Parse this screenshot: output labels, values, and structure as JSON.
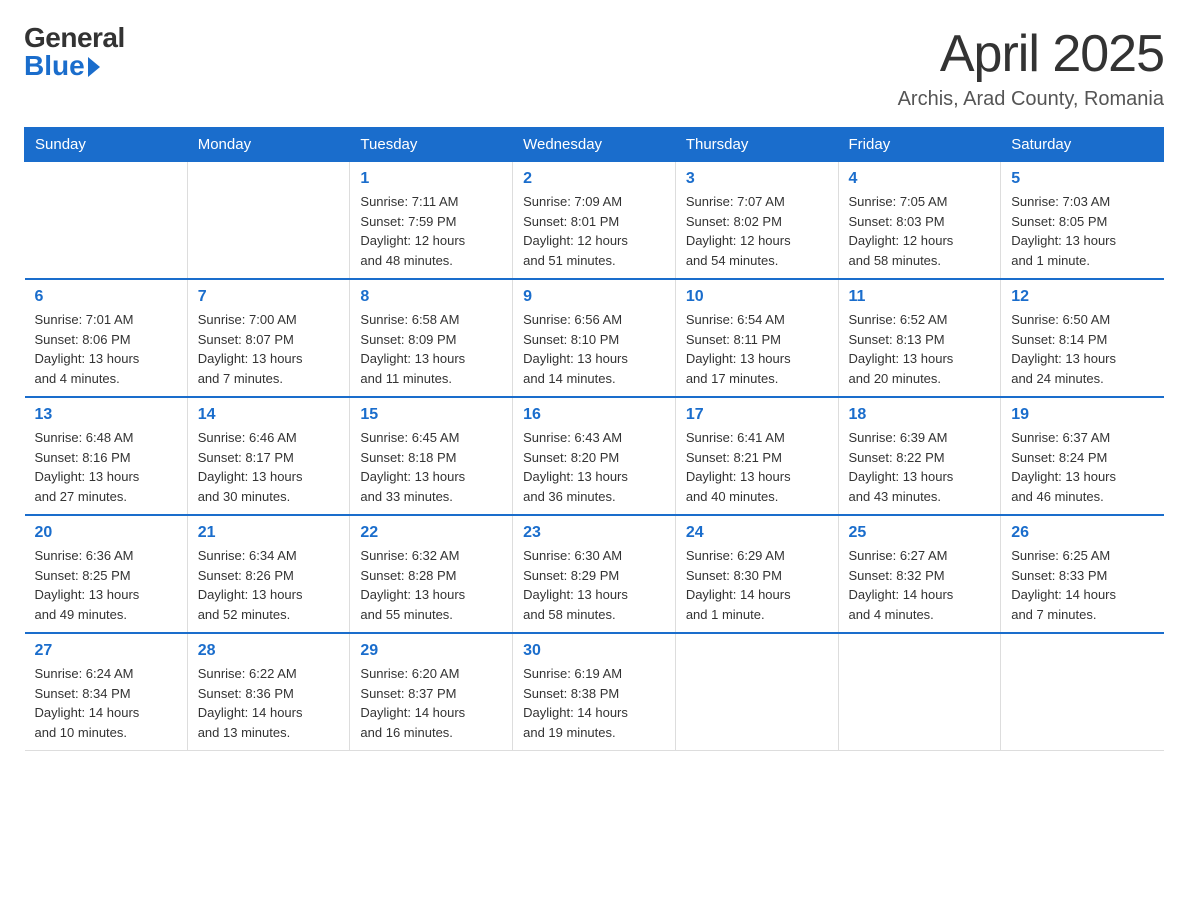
{
  "logo": {
    "general": "General",
    "blue": "Blue"
  },
  "header": {
    "title": "April 2025",
    "subtitle": "Archis, Arad County, Romania"
  },
  "days_header": [
    "Sunday",
    "Monday",
    "Tuesday",
    "Wednesday",
    "Thursday",
    "Friday",
    "Saturday"
  ],
  "weeks": [
    [
      {
        "day": "",
        "info": ""
      },
      {
        "day": "",
        "info": ""
      },
      {
        "day": "1",
        "info": "Sunrise: 7:11 AM\nSunset: 7:59 PM\nDaylight: 12 hours\nand 48 minutes."
      },
      {
        "day": "2",
        "info": "Sunrise: 7:09 AM\nSunset: 8:01 PM\nDaylight: 12 hours\nand 51 minutes."
      },
      {
        "day": "3",
        "info": "Sunrise: 7:07 AM\nSunset: 8:02 PM\nDaylight: 12 hours\nand 54 minutes."
      },
      {
        "day": "4",
        "info": "Sunrise: 7:05 AM\nSunset: 8:03 PM\nDaylight: 12 hours\nand 58 minutes."
      },
      {
        "day": "5",
        "info": "Sunrise: 7:03 AM\nSunset: 8:05 PM\nDaylight: 13 hours\nand 1 minute."
      }
    ],
    [
      {
        "day": "6",
        "info": "Sunrise: 7:01 AM\nSunset: 8:06 PM\nDaylight: 13 hours\nand 4 minutes."
      },
      {
        "day": "7",
        "info": "Sunrise: 7:00 AM\nSunset: 8:07 PM\nDaylight: 13 hours\nand 7 minutes."
      },
      {
        "day": "8",
        "info": "Sunrise: 6:58 AM\nSunset: 8:09 PM\nDaylight: 13 hours\nand 11 minutes."
      },
      {
        "day": "9",
        "info": "Sunrise: 6:56 AM\nSunset: 8:10 PM\nDaylight: 13 hours\nand 14 minutes."
      },
      {
        "day": "10",
        "info": "Sunrise: 6:54 AM\nSunset: 8:11 PM\nDaylight: 13 hours\nand 17 minutes."
      },
      {
        "day": "11",
        "info": "Sunrise: 6:52 AM\nSunset: 8:13 PM\nDaylight: 13 hours\nand 20 minutes."
      },
      {
        "day": "12",
        "info": "Sunrise: 6:50 AM\nSunset: 8:14 PM\nDaylight: 13 hours\nand 24 minutes."
      }
    ],
    [
      {
        "day": "13",
        "info": "Sunrise: 6:48 AM\nSunset: 8:16 PM\nDaylight: 13 hours\nand 27 minutes."
      },
      {
        "day": "14",
        "info": "Sunrise: 6:46 AM\nSunset: 8:17 PM\nDaylight: 13 hours\nand 30 minutes."
      },
      {
        "day": "15",
        "info": "Sunrise: 6:45 AM\nSunset: 8:18 PM\nDaylight: 13 hours\nand 33 minutes."
      },
      {
        "day": "16",
        "info": "Sunrise: 6:43 AM\nSunset: 8:20 PM\nDaylight: 13 hours\nand 36 minutes."
      },
      {
        "day": "17",
        "info": "Sunrise: 6:41 AM\nSunset: 8:21 PM\nDaylight: 13 hours\nand 40 minutes."
      },
      {
        "day": "18",
        "info": "Sunrise: 6:39 AM\nSunset: 8:22 PM\nDaylight: 13 hours\nand 43 minutes."
      },
      {
        "day": "19",
        "info": "Sunrise: 6:37 AM\nSunset: 8:24 PM\nDaylight: 13 hours\nand 46 minutes."
      }
    ],
    [
      {
        "day": "20",
        "info": "Sunrise: 6:36 AM\nSunset: 8:25 PM\nDaylight: 13 hours\nand 49 minutes."
      },
      {
        "day": "21",
        "info": "Sunrise: 6:34 AM\nSunset: 8:26 PM\nDaylight: 13 hours\nand 52 minutes."
      },
      {
        "day": "22",
        "info": "Sunrise: 6:32 AM\nSunset: 8:28 PM\nDaylight: 13 hours\nand 55 minutes."
      },
      {
        "day": "23",
        "info": "Sunrise: 6:30 AM\nSunset: 8:29 PM\nDaylight: 13 hours\nand 58 minutes."
      },
      {
        "day": "24",
        "info": "Sunrise: 6:29 AM\nSunset: 8:30 PM\nDaylight: 14 hours\nand 1 minute."
      },
      {
        "day": "25",
        "info": "Sunrise: 6:27 AM\nSunset: 8:32 PM\nDaylight: 14 hours\nand 4 minutes."
      },
      {
        "day": "26",
        "info": "Sunrise: 6:25 AM\nSunset: 8:33 PM\nDaylight: 14 hours\nand 7 minutes."
      }
    ],
    [
      {
        "day": "27",
        "info": "Sunrise: 6:24 AM\nSunset: 8:34 PM\nDaylight: 14 hours\nand 10 minutes."
      },
      {
        "day": "28",
        "info": "Sunrise: 6:22 AM\nSunset: 8:36 PM\nDaylight: 14 hours\nand 13 minutes."
      },
      {
        "day": "29",
        "info": "Sunrise: 6:20 AM\nSunset: 8:37 PM\nDaylight: 14 hours\nand 16 minutes."
      },
      {
        "day": "30",
        "info": "Sunrise: 6:19 AM\nSunset: 8:38 PM\nDaylight: 14 hours\nand 19 minutes."
      },
      {
        "day": "",
        "info": ""
      },
      {
        "day": "",
        "info": ""
      },
      {
        "day": "",
        "info": ""
      }
    ]
  ]
}
